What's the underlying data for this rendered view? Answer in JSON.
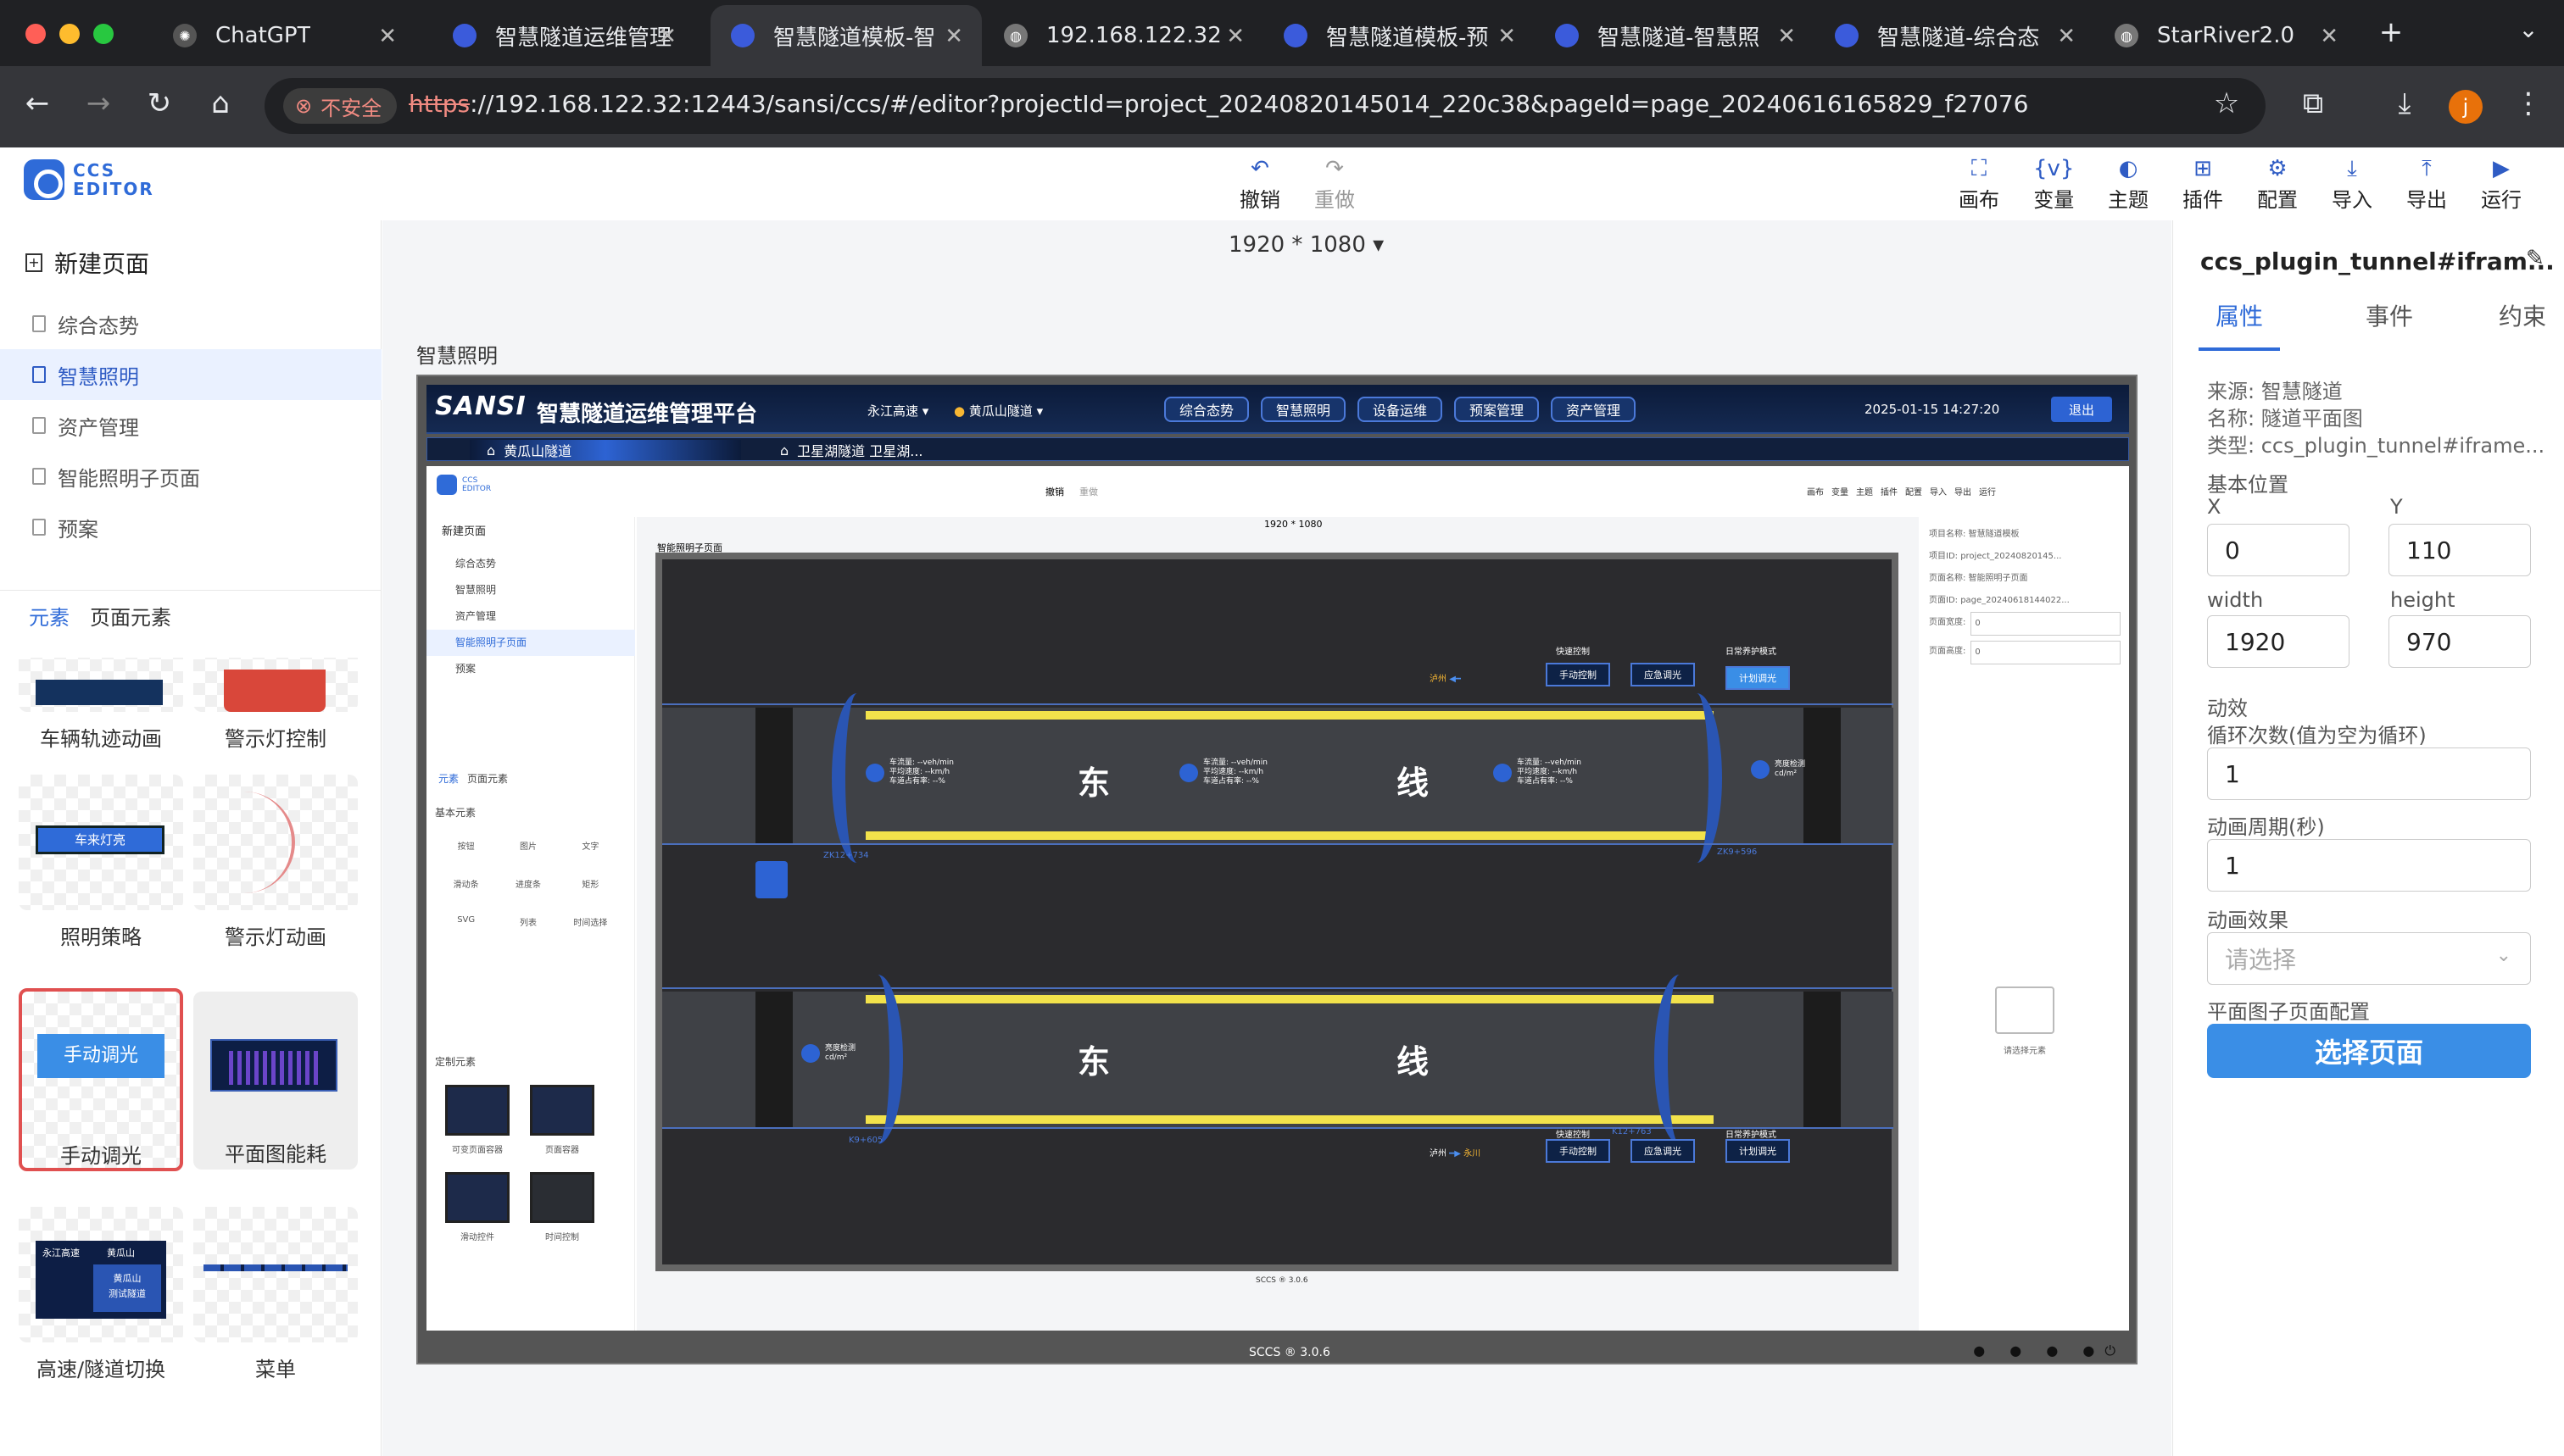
{
  "browser": {
    "tabs": [
      "ChatGPT",
      "智慧隧道运维管理",
      "智慧隧道模板-智",
      "192.168.122.32",
      "智慧隧道模板-预",
      "智慧隧道-智慧照",
      "智慧隧道-综合态",
      "StarRiver2.0"
    ],
    "insecure": "不安全",
    "url_scheme": "https",
    "url_rest": "://192.168.122.32:12443/sansi/ccs/#/editor?projectId=project_20240820145014_220c38&pageId=page_20240616165829_f27076",
    "profile": "j"
  },
  "editor": {
    "logo": [
      "CCS",
      "EDITOR"
    ],
    "undo": "撤销",
    "redo": "重做",
    "size": "1920 * 1080",
    "tools": [
      "画布",
      "变量",
      "主题",
      "插件",
      "配置",
      "导入",
      "导出",
      "运行"
    ]
  },
  "sidebar": {
    "new_page": "新建页面",
    "pages": [
      "综合态势",
      "智慧照明",
      "资产管理",
      "智能照明子页面",
      "预案"
    ],
    "tabs": [
      "元素",
      "页面元素"
    ],
    "components": [
      "车辆轨迹动画",
      "警示灯控制",
      "照明策略",
      "警示灯动画",
      "手动调光",
      "平面图能耗",
      "高速/隧道切换",
      "菜单"
    ],
    "thumb_text": {
      "btn": "手动调光",
      "car": "车来灯亮",
      "sw1": "永江高速",
      "sw2": "黄瓜山",
      "sw3": "黄瓜山",
      "sw4": "测试隧道"
    }
  },
  "canvas": {
    "page_title": "智慧照明",
    "app": {
      "brand": "SANSI",
      "title": "智慧隧道运维管理平台",
      "highway": "永江高速",
      "tunnel": "黄瓜山隧道",
      "nav": [
        "综合态势",
        "智慧照明",
        "设备运维",
        "预案管理",
        "资产管理"
      ],
      "datetime": "2025-01-15 14:27:20",
      "logout": "退出",
      "ttabs": [
        "黄瓜山隧道",
        "卫星湖隧道 卫星湖..."
      ],
      "footer": "SCCS ® 3.0.6"
    },
    "inner": {
      "undo": "撤销",
      "redo": "重做",
      "size": "1920 * 1080",
      "new_page": "新建页面",
      "pages": [
        "综合态势",
        "智慧照明",
        "资产管理",
        "智能照明子页面",
        "预案"
      ],
      "page_title": "智能照明子页面",
      "tabs": [
        "元素",
        "页面元素"
      ],
      "basic": "基本元素",
      "custom": "定制元素",
      "basic_items": [
        "按钮",
        "图片",
        "文字",
        "滑动条",
        "进度条",
        "矩形",
        "SVG",
        "列表",
        "时间选择"
      ],
      "custom_items": [
        "可变页面容器",
        "页面容器",
        "滑动控件",
        "时间控制"
      ],
      "info": [
        "项目名称: 智慧隧道模板",
        "项目ID: project_20240820145...",
        "页面名称: 智能照明子页面",
        "页面ID: page_20240618144022...",
        "页面宽度:",
        "页面高度:"
      ],
      "info_vals": [
        "0",
        "0"
      ],
      "select_hint": "请选择元素",
      "footer": "SCCS ® 3.0.6",
      "tools": [
        "画布",
        "变量",
        "主题",
        "插件",
        "配置",
        "导入",
        "导出",
        "运行"
      ]
    },
    "tunnel": {
      "east": "东",
      "line": "线",
      "quick": "快速控制",
      "daily": "日常养护模式",
      "manual": "手动控制",
      "emergency": "应急调光",
      "plan": "计划调光",
      "dir_top": "泸州",
      "dir_bottom1": "泸州",
      "dir_bottom2": "永川",
      "kp": [
        "ZK12+734",
        "ZK9+596",
        "K9+605",
        "K12+763"
      ],
      "stat": [
        "车流量: --veh/min",
        "平均速度: --km/h",
        "车道占有率: --%"
      ],
      "lum": [
        "亮度检测",
        "cd/m²"
      ]
    }
  },
  "props": {
    "title": "ccs_plugin_tunnel#ifram...",
    "tabs": [
      "属性",
      "事件",
      "约束"
    ],
    "source": "来源: 智慧隧道",
    "name": "名称: 隧道平面图",
    "type": "类型: ccs_plugin_tunnel#iframe...",
    "base_pos": "基本位置",
    "x_label": "X",
    "y_label": "Y",
    "x": "0",
    "y": "110",
    "w_label": "width",
    "h_label": "height",
    "w": "1920",
    "h": "970",
    "anim": "动效",
    "loop_label": "循环次数(值为空为循环)",
    "loop": "1",
    "period_label": "动画周期(秒)",
    "period": "1",
    "effect_label": "动画效果",
    "effect_placeholder": "请选择",
    "sub_label": "平面图子页面配置",
    "select_btn": "选择页面"
  },
  "colors": {
    "accent": "#2f6bd8",
    "brand_dark": "#0c1b3a"
  }
}
